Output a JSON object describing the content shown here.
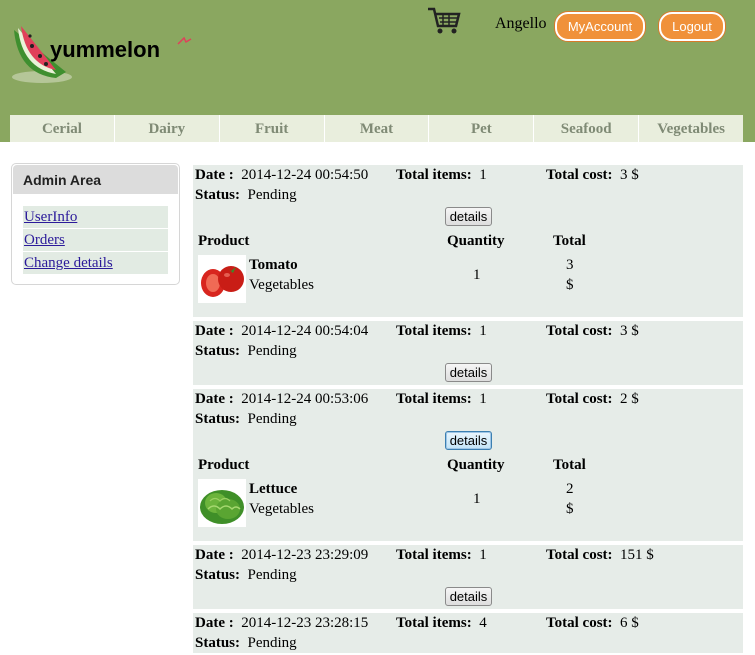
{
  "header": {
    "logo_text": "yummelon",
    "user_name": "Angello",
    "my_account_label": "MyAccount",
    "logout_label": "Logout",
    "icons": {
      "cart": "shopping-cart-icon",
      "logo": "watermelon-logo-icon"
    },
    "colors": {
      "header_bg": "#8aa760",
      "button": "#f0913a"
    }
  },
  "nav": {
    "items": [
      {
        "label": "Cerial"
      },
      {
        "label": "Dairy"
      },
      {
        "label": "Fruit"
      },
      {
        "label": "Meat"
      },
      {
        "label": "Pet"
      },
      {
        "label": "Seafood"
      },
      {
        "label": "Vegetables"
      }
    ]
  },
  "sidebar": {
    "title": "Admin Area",
    "links": [
      {
        "label": "UserInfo"
      },
      {
        "label": "Orders"
      },
      {
        "label": "Change details"
      }
    ]
  },
  "labels": {
    "date": "Date :",
    "total_items": "Total items:",
    "total_cost": "Total cost:",
    "status": "Status:",
    "details": "details",
    "product": "Product",
    "quantity": "Quantity",
    "total": "Total"
  },
  "orders": [
    {
      "date": "2014-12-24 00:54:50",
      "total_items": "1",
      "total_cost": "3 $",
      "status": "Pending",
      "product": {
        "name": "Tomato",
        "category": "Vegetables",
        "quantity": "1",
        "total_value": "3",
        "total_currency": "$",
        "image": "tomato-image"
      }
    },
    {
      "date": "2014-12-24 00:54:04",
      "total_items": "1",
      "total_cost": "3 $",
      "status": "Pending"
    },
    {
      "date": "2014-12-24 00:53:06",
      "total_items": "1",
      "total_cost": "2 $",
      "status": "Pending",
      "product": {
        "name": "Lettuce",
        "category": "Vegetables",
        "quantity": "1",
        "total_value": "2",
        "total_currency": "$",
        "image": "lettuce-image"
      }
    },
    {
      "date": "2014-12-23 23:29:09",
      "total_items": "1",
      "total_cost": "151 $",
      "status": "Pending"
    },
    {
      "date": "2014-12-23 23:28:15",
      "total_items": "4",
      "total_cost": "6 $",
      "status": "Pending"
    }
  ]
}
